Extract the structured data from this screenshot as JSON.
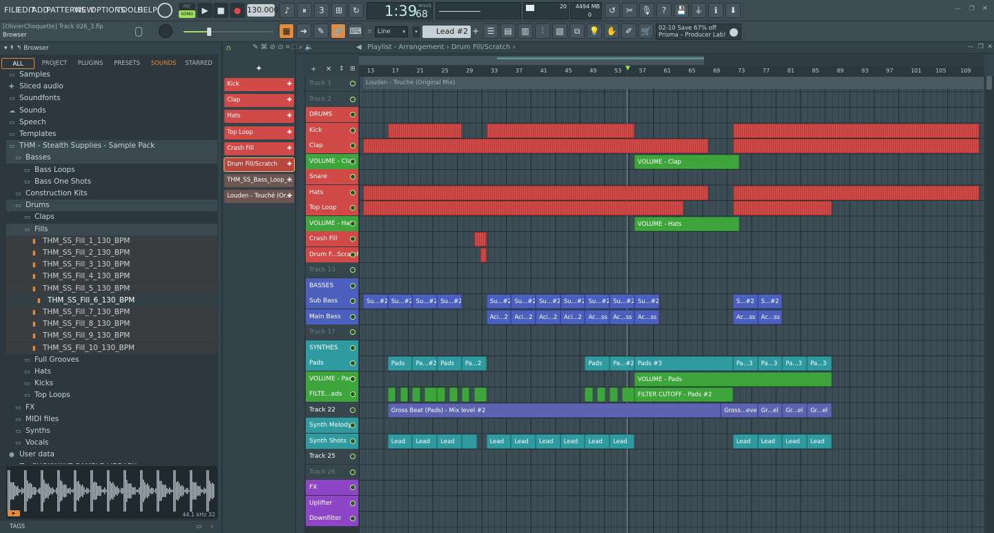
{
  "menu": [
    "FILE",
    "EDIT",
    "ADD",
    "PATTERNS",
    "VIEW",
    "OPTIONS",
    "TOOLS",
    "HELP"
  ],
  "transport": {
    "mode_top": "PAT",
    "mode_bottom": "SONG",
    "tempo": "130.000",
    "time": "1:39",
    "time_sub": "68",
    "time_unit": "M:S:CS"
  },
  "meters": {
    "cpu": "20",
    "memory": "4494 MB",
    "polyphony": "0"
  },
  "project": {
    "user": "[OlivierChoquette] Track 026_3.flp",
    "panel": "Browser"
  },
  "snap": {
    "mode": "Line",
    "pattern": "Lead #2"
  },
  "news": {
    "line1": "02-10  Save 67% off",
    "line2": "Prisma – Producer Lab!"
  },
  "browser": {
    "title": "Browser",
    "tabs": [
      "ALL",
      "PROJECT",
      "PLUGINS",
      "PRESETS",
      "SOUNDS",
      "STARRED"
    ],
    "items": [
      {
        "label": "Samples",
        "icon": "folder-icon",
        "indent": 1
      },
      {
        "label": "Sliced audio",
        "icon": "puzzle-icon",
        "indent": 1
      },
      {
        "label": "Soundfonts",
        "icon": "folder-icon",
        "indent": 1
      },
      {
        "label": "Sounds",
        "icon": "cloud-icon",
        "indent": 1
      },
      {
        "label": "Speech",
        "icon": "folder-icon",
        "indent": 1
      },
      {
        "label": "Templates",
        "icon": "folder-icon",
        "indent": 1
      },
      {
        "label": "THM - Stealth Supplies - Sample Pack",
        "icon": "folder-icon",
        "indent": 1,
        "sel": true
      },
      {
        "label": "Basses",
        "icon": "folder-icon",
        "indent": 2,
        "sel": true
      },
      {
        "label": "Bass Loops",
        "icon": "folder-icon",
        "indent": 3
      },
      {
        "label": "Bass One Shots",
        "icon": "folder-icon",
        "indent": 3
      },
      {
        "label": "Construction Kits",
        "icon": "folder-icon",
        "indent": 2
      },
      {
        "label": "Drums",
        "icon": "folder-icon",
        "indent": 2,
        "sel": true
      },
      {
        "label": "Claps",
        "icon": "folder-icon",
        "indent": 3
      },
      {
        "label": "Fills",
        "icon": "folder-icon",
        "indent": 3,
        "sel": true
      },
      {
        "label": "THM_SS_Fill_1_130_BPM",
        "icon": "wave-file-icon",
        "indent": 4
      },
      {
        "label": "THM_SS_Fill_2_130_BPM",
        "icon": "wave-file-icon",
        "indent": 4
      },
      {
        "label": "THM_SS_Fill_3_130_BPM",
        "icon": "wave-file-icon",
        "indent": 4
      },
      {
        "label": "THM_SS_Fill_4_130_BPM",
        "icon": "wave-file-icon",
        "indent": 4
      },
      {
        "label": "THM_SS_Fill_5_130_BPM",
        "icon": "wave-file-icon",
        "indent": 4
      },
      {
        "label": "THM_SS_Fill_6_130_BPM",
        "icon": "wave-file-icon",
        "indent": 5,
        "active": true
      },
      {
        "label": "THM_SS_Fill_7_130_BPM",
        "icon": "wave-file-icon",
        "indent": 4
      },
      {
        "label": "THM_SS_Fill_8_130_BPM",
        "icon": "wave-file-icon",
        "indent": 4
      },
      {
        "label": "THM_SS_Fill_9_130_BPM",
        "icon": "wave-file-icon",
        "indent": 4
      },
      {
        "label": "THM_SS_Fill_10_130_BPM",
        "icon": "wave-file-icon",
        "indent": 4
      },
      {
        "label": "Full Grooves",
        "icon": "folder-icon",
        "indent": 3
      },
      {
        "label": "Hats",
        "icon": "folder-icon",
        "indent": 3
      },
      {
        "label": "Kicks",
        "icon": "folder-icon",
        "indent": 3
      },
      {
        "label": "Top Loops",
        "icon": "folder-icon",
        "indent": 3
      },
      {
        "label": "FX",
        "icon": "folder-icon",
        "indent": 2
      },
      {
        "label": "MIDI files",
        "icon": "folder-icon",
        "indent": 2
      },
      {
        "label": "Synths",
        "icon": "folder-icon",
        "indent": 2
      },
      {
        "label": "Vocals",
        "icon": "folder-icon",
        "indent": 2
      },
      {
        "label": "User data",
        "icon": "user-icon",
        "indent": 1
      },
      {
        "label": "Z - CHOKWAVE SAMPLE LIBRARY",
        "icon": "folder-icon",
        "indent": 1
      }
    ],
    "sample_info": "44.1 kHz 32",
    "tags_label": "TAGS"
  },
  "patterns": [
    {
      "label": "Kick",
      "color": "#d24a48"
    },
    {
      "label": "Clap",
      "color": "#d24a48"
    },
    {
      "label": "Hats",
      "color": "#d24a48"
    },
    {
      "label": "Top Loop",
      "color": "#d24a48"
    },
    {
      "label": "Crash Fill",
      "color": "#d24a48"
    },
    {
      "label": "Drum Fill/Scratch",
      "color": "#b7473f"
    },
    {
      "label": "THM_SS_Bass_Loop_...",
      "color": "#6d5552"
    },
    {
      "label": "Louden - Touché (Or...",
      "color": "#6d5552"
    }
  ],
  "playlist": {
    "title": "Playlist - Arrangement › Drum Fill/Scratch ›",
    "ruler": [
      "13",
      "17",
      "21",
      "25",
      "29",
      "33",
      "37",
      "41",
      "45",
      "49",
      "53",
      "57",
      "61",
      "65",
      "69",
      "73",
      "77",
      "81",
      "85",
      "89",
      "93",
      "97",
      "101",
      "105",
      "109"
    ],
    "tracks": [
      {
        "label": "Track 1",
        "color": "#37464d",
        "dim": true
      },
      {
        "label": "Track 2",
        "color": "#37464d",
        "dim": true
      },
      {
        "label": "DRUMS",
        "color": "#d24a48",
        "group": true
      },
      {
        "label": "Kick",
        "color": "#d24a48"
      },
      {
        "label": "Clap",
        "color": "#d24a48"
      },
      {
        "label": "VOLUME - Clap",
        "color": "#3ea43c"
      },
      {
        "label": "Snare",
        "color": "#d24a48"
      },
      {
        "label": "Hats",
        "color": "#d24a48"
      },
      {
        "label": "Top Loop",
        "color": "#d24a48"
      },
      {
        "label": "VOLUME - Hats",
        "color": "#3ea43c"
      },
      {
        "label": "Crash Fill",
        "color": "#d24a48"
      },
      {
        "label": "Drum F...Scratch",
        "color": "#d24a48"
      },
      {
        "label": "Track 13",
        "color": "#37464d",
        "dim": true
      },
      {
        "label": "BASSES",
        "color": "#4d5fbd",
        "group": true
      },
      {
        "label": "Sub Bass",
        "color": "#4d5fbd"
      },
      {
        "label": "Main Bass",
        "color": "#4d5fbd"
      },
      {
        "label": "Track 17",
        "color": "#37464d",
        "dim": true
      },
      {
        "label": "SYNTHES",
        "color": "#2f9aa0",
        "group": true
      },
      {
        "label": "Pads",
        "color": "#2f9aa0"
      },
      {
        "label": "VOLUME - Pads",
        "color": "#3ea43c"
      },
      {
        "label": "FILTE...ads",
        "color": "#3ea43c"
      },
      {
        "label": "Track 22",
        "color": "#37464d"
      },
      {
        "label": "Synth Melody",
        "color": "#2f9aa0"
      },
      {
        "label": "Synth Shots",
        "color": "#2f9aa0"
      },
      {
        "label": "Track 25",
        "color": "#37464d"
      },
      {
        "label": "Track 26",
        "color": "#37464d",
        "dim": true
      },
      {
        "label": "FX",
        "color": "#8e45c8",
        "group": true
      },
      {
        "label": "Uplifter",
        "color": "#8e45c8"
      },
      {
        "label": "Downfilter",
        "color": "#8e45c8"
      }
    ],
    "clips": [
      {
        "row": 0,
        "start": 13,
        "end": 114,
        "label": "Louden - Touché (Original Mix)",
        "style": "header"
      },
      {
        "row": 3,
        "start": 17,
        "end": 29,
        "label": "",
        "style": "red"
      },
      {
        "row": 3,
        "start": 33,
        "end": 57,
        "label": "",
        "style": "red"
      },
      {
        "row": 3,
        "start": 73,
        "end": 113,
        "label": "",
        "style": "red"
      },
      {
        "row": 4,
        "start": 13,
        "end": 69,
        "label": "",
        "style": "red"
      },
      {
        "row": 4,
        "start": 73,
        "end": 113,
        "label": "",
        "style": "red"
      },
      {
        "row": 5,
        "start": 57,
        "end": 74,
        "label": "VOLUME - Clap",
        "style": "green"
      },
      {
        "row": 7,
        "start": 13,
        "end": 69,
        "label": "",
        "style": "red"
      },
      {
        "row": 7,
        "start": 73,
        "end": 113,
        "label": "",
        "style": "red"
      },
      {
        "row": 8,
        "start": 13,
        "end": 65,
        "label": "",
        "style": "red"
      },
      {
        "row": 8,
        "start": 73,
        "end": 89,
        "label": "",
        "style": "red"
      },
      {
        "row": 9,
        "start": 57,
        "end": 74,
        "label": "VOLUME - Hats",
        "style": "green"
      },
      {
        "row": 10,
        "start": 31,
        "end": 33,
        "label": "",
        "style": "red"
      },
      {
        "row": 11,
        "start": 32,
        "end": 33,
        "label": "",
        "style": "red"
      },
      {
        "row": 14,
        "start": 13,
        "end": 17,
        "label": "Su...#2",
        "style": "blue"
      },
      {
        "row": 14,
        "start": 17,
        "end": 21,
        "label": "Su...#2",
        "style": "blue"
      },
      {
        "row": 14,
        "start": 21,
        "end": 25,
        "label": "Su...#2",
        "style": "blue"
      },
      {
        "row": 14,
        "start": 25,
        "end": 29,
        "label": "Su...#2",
        "style": "blue"
      },
      {
        "row": 14,
        "start": 33,
        "end": 37,
        "label": "Su...#2",
        "style": "blue"
      },
      {
        "row": 14,
        "start": 37,
        "end": 41,
        "label": "Su...#2",
        "style": "blue"
      },
      {
        "row": 14,
        "start": 41,
        "end": 45,
        "label": "Su...#2",
        "style": "blue"
      },
      {
        "row": 14,
        "start": 45,
        "end": 49,
        "label": "Su...#2",
        "style": "blue"
      },
      {
        "row": 14,
        "start": 49,
        "end": 53,
        "label": "Su...#2",
        "style": "blue"
      },
      {
        "row": 14,
        "start": 53,
        "end": 57,
        "label": "Su...#2",
        "style": "blue"
      },
      {
        "row": 14,
        "start": 57,
        "end": 61,
        "label": "Su...#2",
        "style": "blue"
      },
      {
        "row": 14,
        "start": 73,
        "end": 77,
        "label": "S...#2",
        "style": "blue"
      },
      {
        "row": 14,
        "start": 77,
        "end": 81,
        "label": "S...#2",
        "style": "blue"
      },
      {
        "row": 15,
        "start": 33,
        "end": 37,
        "label": "Aci...2",
        "style": "blue"
      },
      {
        "row": 15,
        "start": 37,
        "end": 41,
        "label": "Aci...2",
        "style": "blue"
      },
      {
        "row": 15,
        "start": 41,
        "end": 45,
        "label": "Aci...2",
        "style": "blue"
      },
      {
        "row": 15,
        "start": 45,
        "end": 49,
        "label": "Aci...2",
        "style": "blue"
      },
      {
        "row": 15,
        "start": 49,
        "end": 53,
        "label": "Ac...ss",
        "style": "blue"
      },
      {
        "row": 15,
        "start": 53,
        "end": 57,
        "label": "Ac...ss",
        "style": "blue"
      },
      {
        "row": 15,
        "start": 57,
        "end": 61,
        "label": "Ac...ss",
        "style": "blue"
      },
      {
        "row": 15,
        "start": 73,
        "end": 77,
        "label": "Ac...ss",
        "style": "blue"
      },
      {
        "row": 15,
        "start": 77,
        "end": 81,
        "label": "Ac...ss",
        "style": "blue"
      },
      {
        "row": 18,
        "start": 17,
        "end": 21,
        "label": "Pads",
        "style": "teal"
      },
      {
        "row": 18,
        "start": 21,
        "end": 25,
        "label": "Pa...#2",
        "style": "teal"
      },
      {
        "row": 18,
        "start": 25,
        "end": 29,
        "label": "Pads",
        "style": "teal"
      },
      {
        "row": 18,
        "start": 29,
        "end": 33,
        "label": "Pa...2",
        "style": "teal"
      },
      {
        "row": 18,
        "start": 49,
        "end": 53,
        "label": "Pads",
        "style": "teal"
      },
      {
        "row": 18,
        "start": 53,
        "end": 57,
        "label": "Pa...#2",
        "style": "teal"
      },
      {
        "row": 18,
        "start": 57,
        "end": 73,
        "label": "Pads #3",
        "style": "teal"
      },
      {
        "row": 18,
        "start": 73,
        "end": 77,
        "label": "Pa...3",
        "style": "teal"
      },
      {
        "row": 18,
        "start": 77,
        "end": 81,
        "label": "Pa...3",
        "style": "teal"
      },
      {
        "row": 18,
        "start": 81,
        "end": 85,
        "label": "Pa...3",
        "style": "teal"
      },
      {
        "row": 18,
        "start": 85,
        "end": 89,
        "label": "Pa...3",
        "style": "teal"
      },
      {
        "row": 19,
        "start": 57,
        "end": 89,
        "label": "VOLUME - Pads",
        "style": "green"
      },
      {
        "row": 20,
        "start": 17,
        "end": 18.3,
        "label": "",
        "style": "green"
      },
      {
        "row": 20,
        "start": 19,
        "end": 20.3,
        "label": "",
        "style": "green"
      },
      {
        "row": 20,
        "start": 21,
        "end": 22.3,
        "label": "",
        "style": "green"
      },
      {
        "row": 20,
        "start": 23,
        "end": 25,
        "label": "",
        "style": "green"
      },
      {
        "row": 20,
        "start": 25,
        "end": 26.3,
        "label": "",
        "style": "green"
      },
      {
        "row": 20,
        "start": 27,
        "end": 28.3,
        "label": "",
        "style": "green"
      },
      {
        "row": 20,
        "start": 29,
        "end": 30.3,
        "label": "",
        "style": "green"
      },
      {
        "row": 20,
        "start": 31,
        "end": 33,
        "label": "",
        "style": "green"
      },
      {
        "row": 20,
        "start": 49,
        "end": 50.3,
        "label": "",
        "style": "green"
      },
      {
        "row": 20,
        "start": 51,
        "end": 52.3,
        "label": "",
        "style": "green"
      },
      {
        "row": 20,
        "start": 53,
        "end": 54.3,
        "label": "",
        "style": "green"
      },
      {
        "row": 20,
        "start": 55,
        "end": 57,
        "label": "",
        "style": "green"
      },
      {
        "row": 20,
        "start": 57,
        "end": 73,
        "label": "FILTER CUTOFF - Pads #2",
        "style": "green"
      },
      {
        "row": 21,
        "start": 17,
        "end": 71,
        "label": "Gross Beat (Pads) - Mix level #2",
        "style": "purple"
      },
      {
        "row": 21,
        "start": 71,
        "end": 77,
        "label": "Gross...evel",
        "style": "purple"
      },
      {
        "row": 21,
        "start": 77,
        "end": 81,
        "label": "Gr...el",
        "style": "purple"
      },
      {
        "row": 21,
        "start": 81,
        "end": 85,
        "label": "Gr...el",
        "style": "purple"
      },
      {
        "row": 21,
        "start": 85,
        "end": 89,
        "label": "Gr...el",
        "style": "purple"
      },
      {
        "row": 23,
        "start": 17,
        "end": 21,
        "label": "Lead",
        "style": "teal"
      },
      {
        "row": 23,
        "start": 21,
        "end": 25,
        "label": "Lead",
        "style": "teal"
      },
      {
        "row": 23,
        "start": 25,
        "end": 29,
        "label": "Lead",
        "style": "teal"
      },
      {
        "row": 23,
        "start": 29,
        "end": 31.5,
        "label": "",
        "style": "teal"
      },
      {
        "row": 23,
        "start": 33,
        "end": 37,
        "label": "Lead",
        "style": "teal"
      },
      {
        "row": 23,
        "start": 37,
        "end": 41,
        "label": "Lead",
        "style": "teal"
      },
      {
        "row": 23,
        "start": 41,
        "end": 45,
        "label": "Lead",
        "style": "teal"
      },
      {
        "row": 23,
        "start": 45,
        "end": 49,
        "label": "Lead",
        "style": "teal"
      },
      {
        "row": 23,
        "start": 49,
        "end": 53,
        "label": "Lead",
        "style": "teal"
      },
      {
        "row": 23,
        "start": 53,
        "end": 57,
        "label": "Lead",
        "style": "teal"
      },
      {
        "row": 23,
        "start": 73,
        "end": 77,
        "label": "Lead",
        "style": "teal"
      },
      {
        "row": 23,
        "start": 77,
        "end": 81,
        "label": "Lead",
        "style": "teal"
      },
      {
        "row": 23,
        "start": 81,
        "end": 85,
        "label": "Lead",
        "style": "teal"
      },
      {
        "row": 23,
        "start": 85,
        "end": 89,
        "label": "Lead",
        "style": "teal"
      }
    ]
  },
  "colors": {
    "accent": "#e28b3c",
    "drums": "#d24a48",
    "bass": "#4d5fbd",
    "synth": "#2f9aa0",
    "automation": "#3ea43c",
    "fx": "#8e45c8"
  }
}
